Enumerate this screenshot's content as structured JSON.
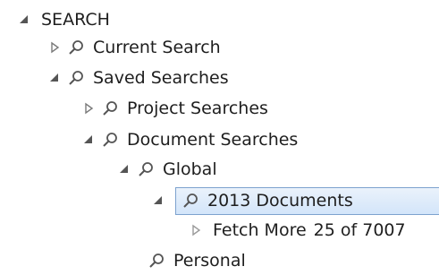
{
  "tree": {
    "root": {
      "label": "SEARCH",
      "expanded": true
    },
    "current_search": {
      "label": "Current Search",
      "expanded": false
    },
    "saved_searches": {
      "label": "Saved Searches",
      "expanded": true
    },
    "project_searches": {
      "label": "Project Searches",
      "expanded": false
    },
    "document_searches": {
      "label": "Document Searches",
      "expanded": true
    },
    "global": {
      "label": "Global",
      "expanded": true
    },
    "docs_2013": {
      "label": "2013 Documents",
      "expanded": true,
      "selected": true
    },
    "fetch_more": {
      "label": "Fetch More",
      "count": "25 of 7007"
    },
    "personal": {
      "label": "Personal"
    }
  },
  "colors": {
    "text": "#1e1e1e",
    "glyph": "#555555",
    "selection_border": "#7da2ce",
    "selection_fill": "#dbe9fa"
  },
  "icons": {
    "expanded": "triangle-down-right-icon",
    "collapsed": "triangle-right-outline-icon",
    "search": "magnifier-icon"
  }
}
